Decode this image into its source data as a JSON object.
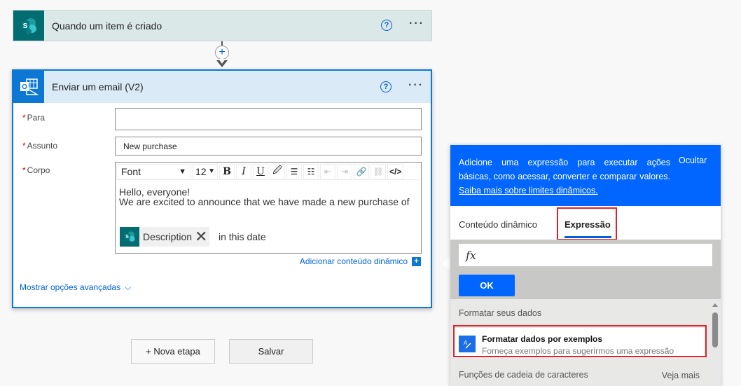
{
  "trigger_card": {
    "title": "Quando um item é criado",
    "icon": "sharepoint-icon",
    "help": "?",
    "more": "···"
  },
  "connector": {
    "add_symbol": "+"
  },
  "action_card": {
    "title": "Enviar um email (V2)",
    "icon": "outlook-icon",
    "help": "?",
    "more": "···",
    "fields": {
      "para": {
        "label": "Para",
        "required": "*",
        "value": ""
      },
      "assunto": {
        "label": "Assunto",
        "required": "*",
        "value": "New purchase"
      },
      "corpo": {
        "label": "Corpo",
        "required": "*"
      }
    },
    "toolbar": {
      "font": "Font",
      "font_arrow": "▼",
      "size": "12",
      "size_arrow": "▼",
      "bold": "B",
      "italic": "I",
      "underline": "U",
      "color": "🖉",
      "bullets": "☰",
      "numbered": "☷",
      "indent_decrease": "⇤",
      "indent_increase": "⇥",
      "link": "🔗",
      "unlink": "⛓",
      "code": "</>"
    },
    "body": {
      "line1": "Hello, everyone!",
      "line2": "We are excited to announce that we have made a new purchase of",
      "token_label": "Description",
      "token_remove": "✕",
      "after_token": "in this date"
    },
    "add_dynamic": "Adicionar conteúdo dinâmico",
    "add_dynamic_symbol": "+",
    "advanced": "Mostrar opções avançadas",
    "advanced_chevron": "⌵"
  },
  "buttons": {
    "new_step": "+ Nova etapa",
    "save": "Salvar"
  },
  "panel": {
    "banner_text": "Adicione uma expressão para executar ações básicas, como acessar, converter e comparar valores.",
    "banner_link": "Saiba mais sobre limites dinâmicos.",
    "hide": "Ocultar",
    "tabs": [
      {
        "label": "Conteúdo dinâmico",
        "active": false
      },
      {
        "label": "Expressão",
        "active": true
      }
    ],
    "fx_symbol": "fx",
    "fx_value": "",
    "ok": "OK",
    "section1": "Formatar seus dados",
    "item": {
      "title": "Formatar dados por exemplos",
      "subtitle": "Forneça exemplos para sugerirmos uma expressão",
      "icon": "format-by-example-icon"
    },
    "section2": "Funções de cadeia de caracteres",
    "see_more": "Veja mais"
  },
  "colors": {
    "accent": "#0066ff",
    "action_border": "#0c78d4",
    "sharepoint": "#036c70",
    "highlight_red": "#e0202a"
  }
}
